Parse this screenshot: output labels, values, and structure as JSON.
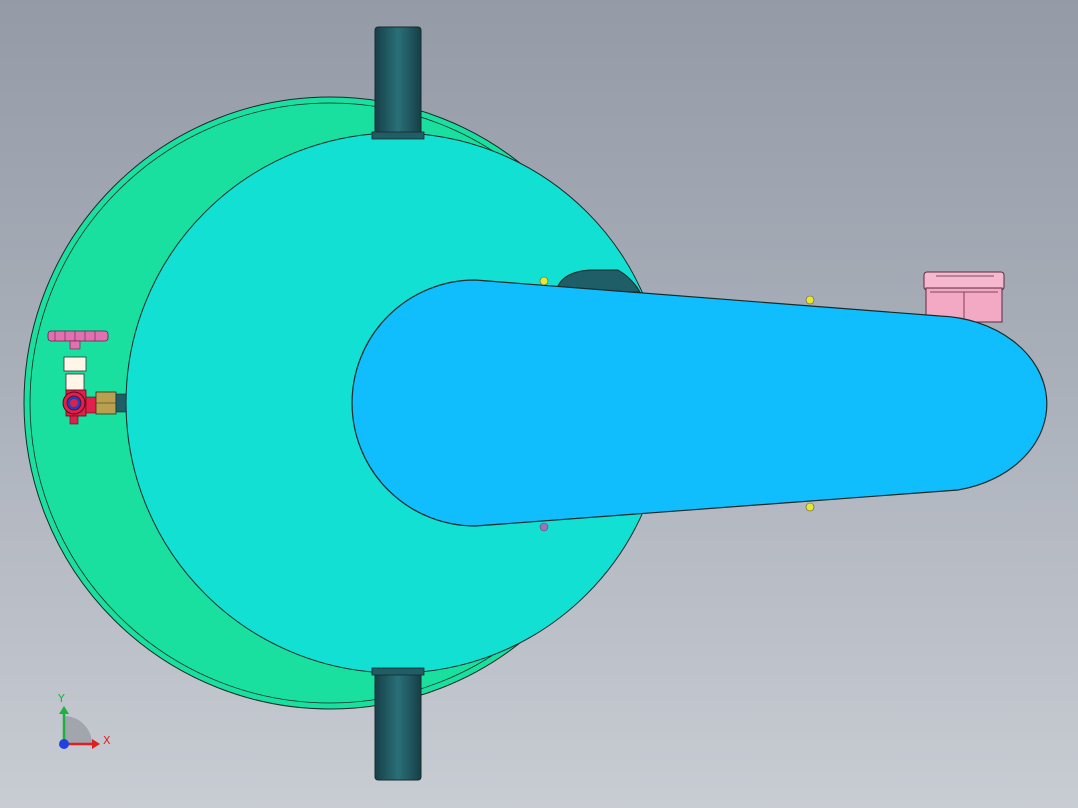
{
  "viewport": {
    "background_top": "#949ba7",
    "background_bottom": "#c8ccd3"
  },
  "model": {
    "colors": {
      "outer_disc": "#19e09e",
      "inner_disc": "#12e0d2",
      "arm": "#10bdfd",
      "clamp": "#1f5e66",
      "edge": "#1a2a2a",
      "valve_handwheel": "#e070b0",
      "valve_body": "#e0204a",
      "fitting": "#b8a050",
      "motor_box": "#f3a8c4",
      "marker_yellow": "#e8e82a",
      "marker_purple": "#a070c0"
    },
    "parts": {
      "outer_disc": "outer-disc",
      "inner_disc": "inner-disc",
      "arm": "swing-arm",
      "clamp_top": "clamp-top",
      "clamp_bottom": "clamp-bottom",
      "valve": "needle-valve",
      "motor": "motor-box"
    }
  },
  "triad": {
    "x_label": "X",
    "y_label": "Y",
    "x_color": "#e02020",
    "y_color": "#20b040",
    "z_color": "#2040e0",
    "icon": "coordinate-triad-icon"
  }
}
